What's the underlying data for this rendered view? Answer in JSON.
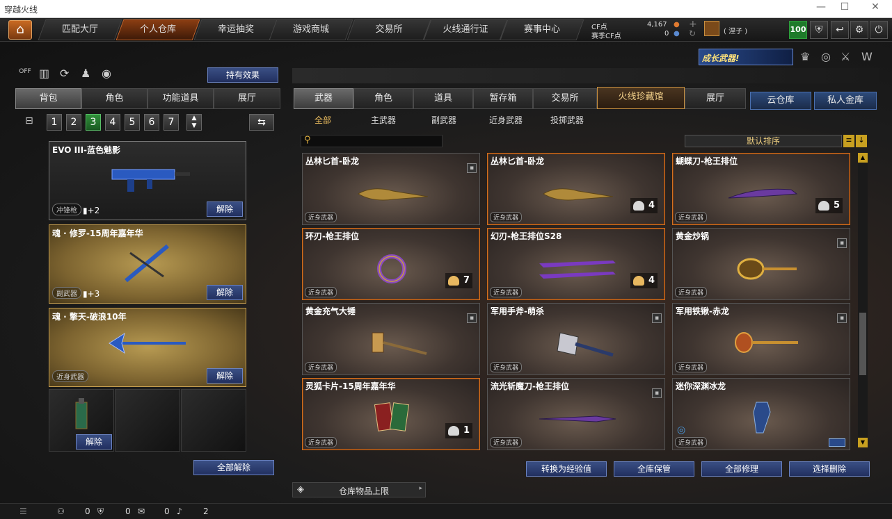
{
  "window": {
    "title": "穿越火线"
  },
  "nav": {
    "tabs": [
      "匹配大厅",
      "个人仓库",
      "幸运抽奖",
      "游戏商城",
      "交易所",
      "火线通行证",
      "赛事中心"
    ],
    "active": "个人仓库"
  },
  "currency": {
    "cf_label": "CF点",
    "cf_value": "4,167",
    "event_label": "赛季CF点",
    "event_value": "0"
  },
  "user": {
    "name": "( 涅子 )",
    "level": "100"
  },
  "left": {
    "effects_button": "持有效果",
    "tabs": [
      "背包",
      "角色",
      "功能道具",
      "展厅"
    ],
    "bag_numbers": [
      "1",
      "2",
      "3",
      "4",
      "5",
      "6",
      "7"
    ],
    "active_bag": "3",
    "cards": [
      {
        "name": "EVO III-蓝色魅影",
        "cat": "冲锋枪",
        "extra": "▮+2",
        "btn": "解除"
      },
      {
        "name": "魂 · 修罗-15周年嘉年华",
        "cat": "副武器",
        "extra": "▮+3",
        "btn": "解除"
      },
      {
        "name": "魂 · 擎天-破浪10年",
        "cat": "近身武器",
        "extra": "",
        "btn": "解除"
      }
    ],
    "grenade_btn": "解除",
    "unequip_all": "全部解除"
  },
  "right": {
    "banner": "成长武器!",
    "tabs": [
      "武器",
      "角色",
      "道具",
      "暂存箱",
      "交易所",
      "火线珍藏馆",
      "展厅"
    ],
    "cloud_tabs": [
      "云仓库",
      "私人金库"
    ],
    "subtabs": [
      "全部",
      "主武器",
      "副武器",
      "近身武器",
      "投掷武器"
    ],
    "sort": "默认排序",
    "items": [
      {
        "name": "丛林匕首-卧龙",
        "tag": "近身武器",
        "count": ""
      },
      {
        "name": "丛林匕首-卧龙",
        "tag": "近身武器",
        "count": "4"
      },
      {
        "name": "蝴蝶刀-枪王排位",
        "tag": "近身武器",
        "count": "5"
      },
      {
        "name": "环刃-枪王排位",
        "tag": "近身武器",
        "count": "7"
      },
      {
        "name": "幻刃-枪王排位S28",
        "tag": "近身武器",
        "count": "4"
      },
      {
        "name": "黄金炒锅",
        "tag": "近身武器",
        "count": ""
      },
      {
        "name": "黄金充气大锤",
        "tag": "近身武器",
        "count": ""
      },
      {
        "name": "军用手斧-萌杀",
        "tag": "近身武器",
        "count": ""
      },
      {
        "name": "军用铁锹-赤龙",
        "tag": "近身武器",
        "count": ""
      },
      {
        "name": "灵狐卡片-15周年嘉年华",
        "tag": "近身武器",
        "count": "1"
      },
      {
        "name": "流光斩魔刀-枪王排位",
        "tag": "近身武器",
        "count": ""
      },
      {
        "name": "迷你深渊冰龙",
        "tag": "近身武器",
        "count": ""
      }
    ],
    "actions": [
      "转换为经验值",
      "全库保管",
      "全部修理",
      "选择删除"
    ],
    "limit": "仓库物品上限"
  },
  "status": {
    "v1": "0",
    "v2": "0",
    "v3": "0",
    "v4": "2"
  },
  "colors": {
    "accent": "#d2701f",
    "tab_active": "#8a3d12",
    "button_blue": "#3a4f84"
  }
}
